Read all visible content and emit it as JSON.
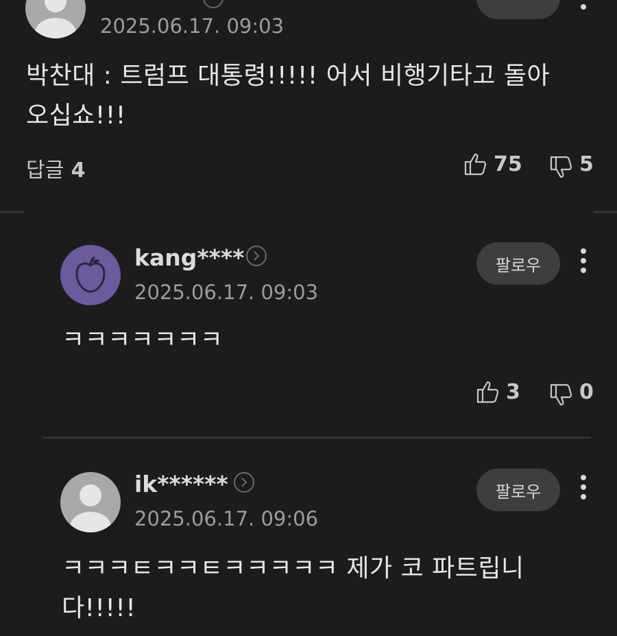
{
  "top_comment": {
    "timestamp": "2025.06.17. 09:03",
    "follow_label": "",
    "text_line1": "박찬대 : 트럼프 대통령!!!!! 어서 비행기타고 돌아",
    "text_line2": "오십쇼!!!",
    "replies_label": "답글",
    "replies_count": "4",
    "likes": "75",
    "dislikes": "5"
  },
  "replies": [
    {
      "username": "kang****",
      "timestamp": "2025.06.17. 09:03",
      "follow_label": "팔로우",
      "text_line1": "ㅋㅋㅋㅋㅋㅋㅋ",
      "likes": "3",
      "dislikes": "0",
      "avatar": "apple-icon"
    },
    {
      "username": "ik******",
      "timestamp": "2025.06.17. 09:06",
      "follow_label": "팔로우",
      "text_line1": "ㅋㅋㅋㅌㅋㅋㅌㅋㅋㅋㅋㅋ 제가 코 파트립니",
      "text_line2": "다!!!!!",
      "avatar": "default-user-icon"
    }
  ],
  "colors": {
    "background": "#1c1c1e",
    "follow_button": "#3e3e40",
    "avatar_purple": "#6b5a9c",
    "avatar_gray": "#a8a8ab"
  }
}
